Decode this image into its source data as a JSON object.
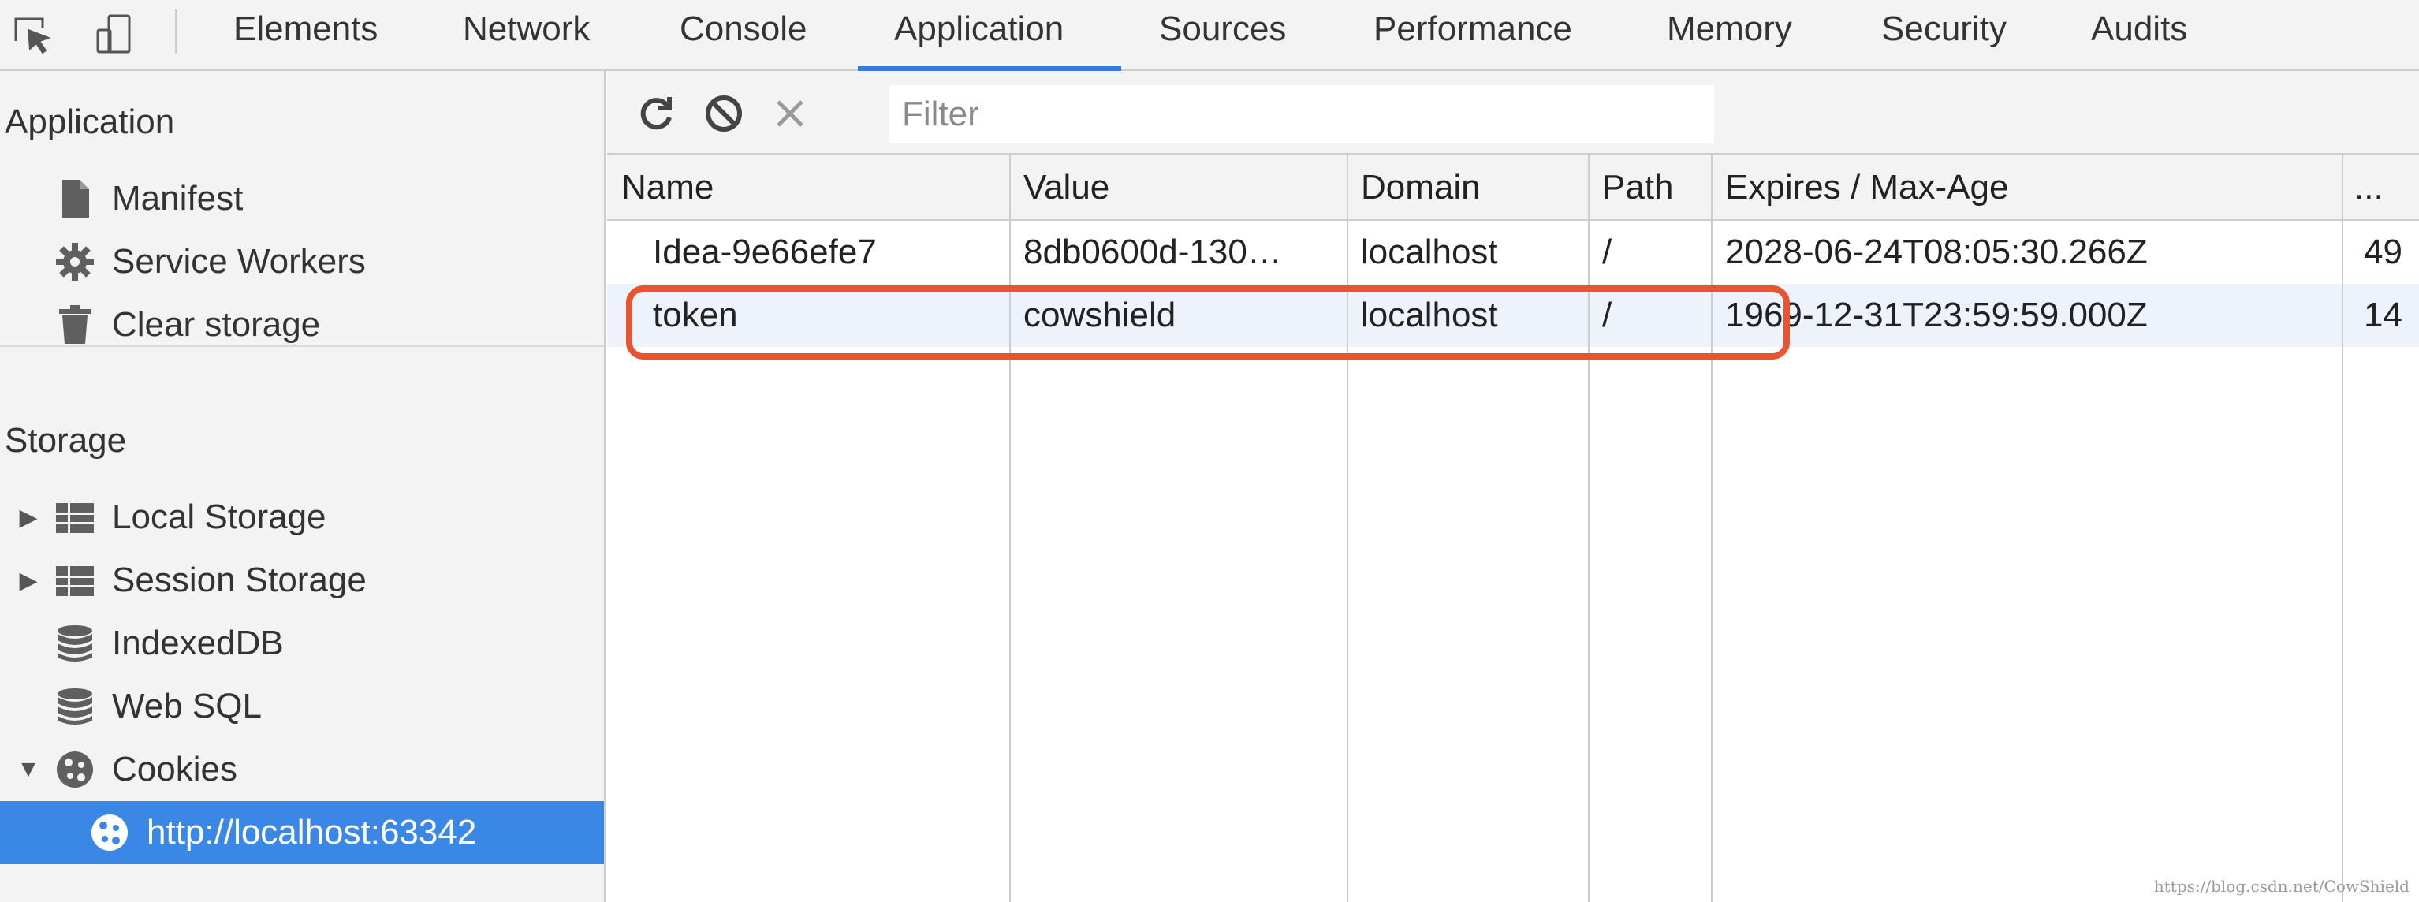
{
  "topbar": {
    "tool_icons": [
      "inspect-element-icon",
      "device-toolbar-icon"
    ],
    "tabs": [
      {
        "label": "Elements"
      },
      {
        "label": "Network"
      },
      {
        "label": "Console"
      },
      {
        "label": "Application",
        "active": true
      },
      {
        "label": "Sources"
      },
      {
        "label": "Performance"
      },
      {
        "label": "Memory"
      },
      {
        "label": "Security"
      },
      {
        "label": "Audits"
      }
    ]
  },
  "sidebar": {
    "application_title": "Application",
    "application_items": [
      {
        "label": "Manifest",
        "icon": "document-icon"
      },
      {
        "label": "Service Workers",
        "icon": "gear-icon"
      },
      {
        "label": "Clear storage",
        "icon": "trash-icon"
      }
    ],
    "storage_title": "Storage",
    "storage_items": [
      {
        "label": "Local Storage",
        "icon": "grid-icon",
        "expandable": true,
        "expanded": false
      },
      {
        "label": "Session Storage",
        "icon": "grid-icon",
        "expandable": true,
        "expanded": false
      },
      {
        "label": "IndexedDB",
        "icon": "database-icon"
      },
      {
        "label": "Web SQL",
        "icon": "database-icon"
      },
      {
        "label": "Cookies",
        "icon": "cookie-icon",
        "expandable": true,
        "expanded": true
      }
    ],
    "cookie_origin": {
      "label": "http://localhost:63342",
      "icon": "cookie-icon",
      "selected": true
    }
  },
  "toolbar": {
    "buttons": [
      "refresh-icon",
      "clear-all-icon",
      "delete-selected-icon"
    ],
    "filter_placeholder": "Filter"
  },
  "table": {
    "columns": [
      "Name",
      "Value",
      "Domain",
      "Path",
      "Expires / Max-Age",
      "..."
    ],
    "rows": [
      {
        "name": "Idea-9e66efe7",
        "value": "8db0600d-130…",
        "domain": "localhost",
        "path": "/",
        "expires": "2028-06-24T08:05:30.266Z",
        "size": "49"
      },
      {
        "name": "token",
        "value": "cowshield",
        "domain": "localhost",
        "path": "/",
        "expires": "1969-12-31T23:59:59.000Z",
        "size": "14"
      }
    ]
  },
  "annotation": {
    "color": "#e8542f",
    "highlighted_row": "token"
  },
  "colors": {
    "accent": "#3879d9",
    "selection": "#3b87e6",
    "panel_bg": "#f3f3f3"
  },
  "watermark": "https://blog.csdn.net/CowShield"
}
